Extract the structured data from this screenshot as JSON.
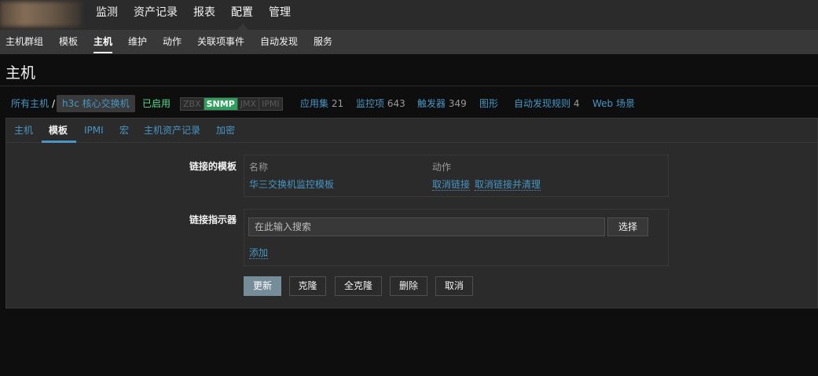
{
  "topnav": {
    "items": [
      {
        "label": "监测"
      },
      {
        "label": "资产记录"
      },
      {
        "label": "报表"
      },
      {
        "label": "配置"
      },
      {
        "label": "管理"
      }
    ]
  },
  "subnav": {
    "items": [
      {
        "label": "主机群组"
      },
      {
        "label": "模板"
      },
      {
        "label": "主机"
      },
      {
        "label": "维护"
      },
      {
        "label": "动作"
      },
      {
        "label": "关联项事件"
      },
      {
        "label": "自动发现"
      },
      {
        "label": "服务"
      }
    ]
  },
  "page": {
    "title": "主机"
  },
  "breadcrumb": {
    "all_hosts": "所有主机",
    "separator": "/",
    "host": "h3c 核心交换机",
    "status": "已启用",
    "availability": [
      {
        "label": "ZBX",
        "active": false
      },
      {
        "label": "SNMP",
        "active": true
      },
      {
        "label": "JMX",
        "active": false
      },
      {
        "label": "IPMI",
        "active": false
      }
    ],
    "links": [
      {
        "label": "应用集",
        "count": "21"
      },
      {
        "label": "监控项",
        "count": "643"
      },
      {
        "label": "触发器",
        "count": "349"
      },
      {
        "label": "图形",
        "count": ""
      },
      {
        "label": "自动发现规则",
        "count": "4"
      },
      {
        "label": "Web 场景",
        "count": ""
      }
    ]
  },
  "tabs": [
    {
      "label": "主机"
    },
    {
      "label": "模板"
    },
    {
      "label": "IPMI"
    },
    {
      "label": "宏"
    },
    {
      "label": "主机资产记录"
    },
    {
      "label": "加密"
    }
  ],
  "linked_templates": {
    "label": "链接的模板",
    "col_name": "名称",
    "col_action": "动作",
    "rows": [
      {
        "name": "华三交换机监控模板",
        "unlink": "取消链接",
        "unlink_clear": "取消链接并清理"
      }
    ]
  },
  "link_indicator": {
    "label": "链接指示器",
    "placeholder": "在此输入搜索",
    "select_label": "选择",
    "add_label": "添加"
  },
  "buttons": {
    "update": "更新",
    "clone": "克隆",
    "full_clone": "全克隆",
    "delete": "删除",
    "cancel": "取消"
  },
  "colors": {
    "link": "#4796c4",
    "enabled": "#59db8f",
    "snmp_available": "#2f9f5e",
    "primary_button": "#768d99"
  }
}
